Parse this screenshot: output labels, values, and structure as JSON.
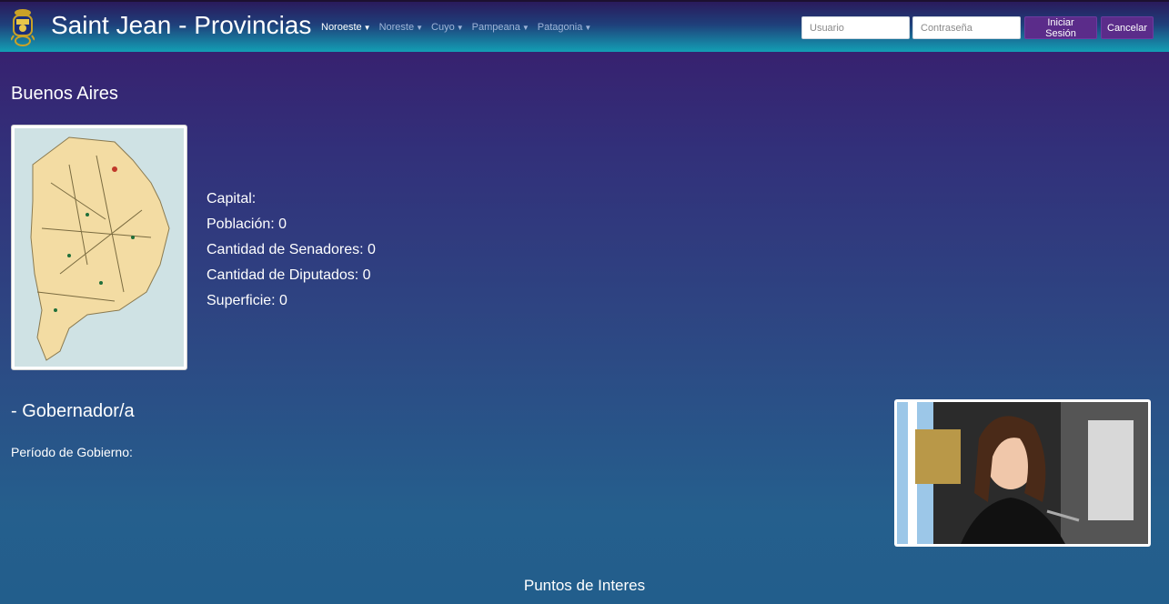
{
  "header": {
    "logo_icon": "coat-of-arms-icon",
    "title": "Saint Jean - Provincias",
    "menu": [
      {
        "label": "Noroeste",
        "active": true
      },
      {
        "label": "Noreste",
        "active": false
      },
      {
        "label": "Cuyo",
        "active": false
      },
      {
        "label": "Pampeana",
        "active": false
      },
      {
        "label": "Patagonia",
        "active": false
      }
    ],
    "login": {
      "user_placeholder": "Usuario",
      "password_placeholder": "Contraseña",
      "login_label": "Iniciar Sesión",
      "cancel_label": "Cancelar"
    }
  },
  "province": {
    "name": "Buenos Aires",
    "map_icon": "province-map-image",
    "info": {
      "capital": "Capital:",
      "population": "Población: 0",
      "senators": "Cantidad de Senadores: 0",
      "deputies": "Cantidad de Diputados: 0",
      "surface": "Superficie: 0"
    }
  },
  "governor": {
    "title": "- Gobernador/a",
    "period": "Período de Gobierno:",
    "photo_icon": "governor-photo-image"
  },
  "points_of_interest": {
    "title": "Puntos de Interes"
  },
  "colors": {
    "accent": "#5b2c8a",
    "nav_active": "#ffffff",
    "nav_inactive": "#9fb4d8"
  }
}
